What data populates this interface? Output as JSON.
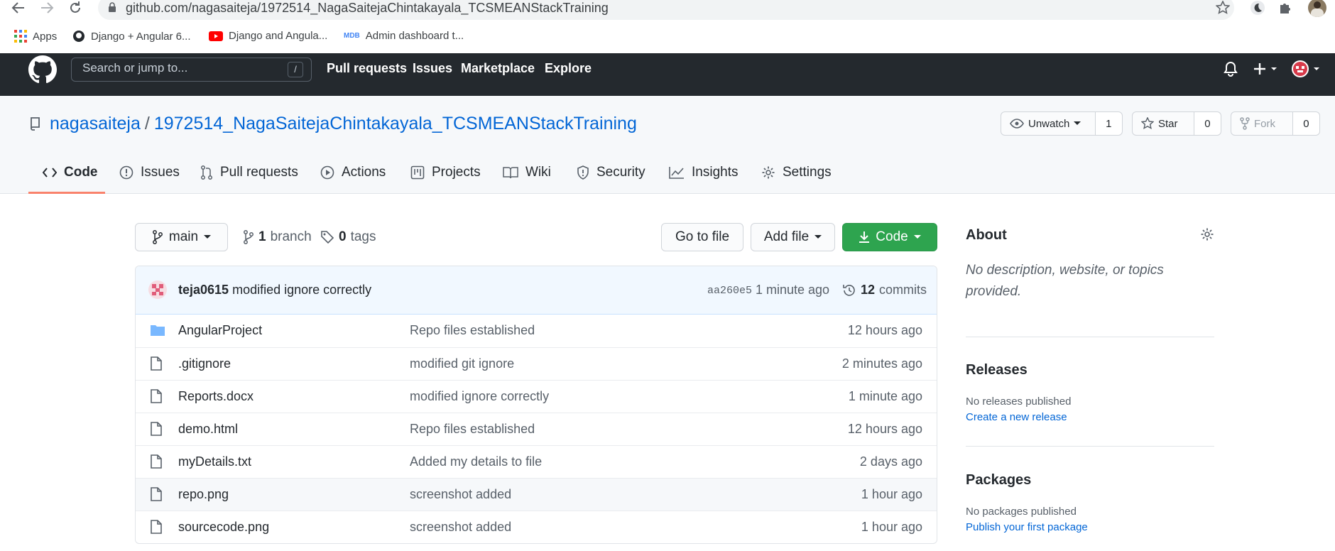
{
  "browser": {
    "url": "github.com/nagasaiteja/1972514_NagaSaitejaChintakayala_TCSMEANStackTraining",
    "bookmarks": [
      {
        "label": "Apps",
        "icon": "apps-grid-icon"
      },
      {
        "label": "Django + Angular 6...",
        "icon": "github-favicon"
      },
      {
        "label": "Django and Angula...",
        "icon": "youtube-favicon"
      },
      {
        "label": "Admin dashboard t...",
        "icon": "mdb-favicon"
      }
    ]
  },
  "header": {
    "search_placeholder": "Search or jump to...",
    "search_shortcut": "/",
    "nav": [
      "Pull requests",
      "Issues",
      "Marketplace",
      "Explore"
    ]
  },
  "repo": {
    "owner": "nagasaiteja",
    "separator": "/",
    "name": "1972514_NagaSaitejaChintakayala_TCSMEANStackTraining",
    "unwatch_label": "Unwatch",
    "watch_count": "1",
    "star_label": "Star",
    "star_count": "0",
    "fork_label": "Fork",
    "fork_count": "0",
    "tabs": [
      "Code",
      "Issues",
      "Pull requests",
      "Actions",
      "Projects",
      "Wiki",
      "Security",
      "Insights",
      "Settings"
    ]
  },
  "toolbar": {
    "branch": "main",
    "branch_count": "1",
    "branch_label": "branch",
    "tag_count": "0",
    "tag_label": "tags",
    "go_to_file": "Go to file",
    "add_file": "Add file",
    "code": "Code"
  },
  "commit": {
    "author": "teja0615",
    "message": "modified ignore correctly",
    "sha": "aa260e5",
    "time": "1 minute ago",
    "count": "12",
    "count_label": "commits"
  },
  "files": [
    {
      "name": "AngularProject",
      "type": "folder",
      "message": "Repo files established",
      "age": "12 hours ago"
    },
    {
      "name": ".gitignore",
      "type": "file",
      "message": "modified git ignore",
      "age": "2 minutes ago"
    },
    {
      "name": "Reports.docx",
      "type": "file",
      "message": "modified ignore correctly",
      "age": "1 minute ago"
    },
    {
      "name": "demo.html",
      "type": "file",
      "message": "Repo files established",
      "age": "12 hours ago"
    },
    {
      "name": "myDetails.txt",
      "type": "file",
      "message": "Added my details to file",
      "age": "2 days ago"
    },
    {
      "name": "repo.png",
      "type": "file",
      "message": "screenshot added",
      "age": "1 hour ago"
    },
    {
      "name": "sourcecode.png",
      "type": "file",
      "message": "screenshot added",
      "age": "1 hour ago"
    }
  ],
  "sidebar": {
    "about_title": "About",
    "about_text": "No description, website, or topics provided.",
    "releases_title": "Releases",
    "releases_text": "No releases published",
    "releases_link": "Create a new release",
    "packages_title": "Packages",
    "packages_text": "No packages published",
    "packages_link": "Publish your first package"
  },
  "colors": {
    "header_bg": "#24292e",
    "link": "#0366d6",
    "code_button": "#2ea44f",
    "active_tab": "#f9826c",
    "folder": "#79b8ff"
  }
}
